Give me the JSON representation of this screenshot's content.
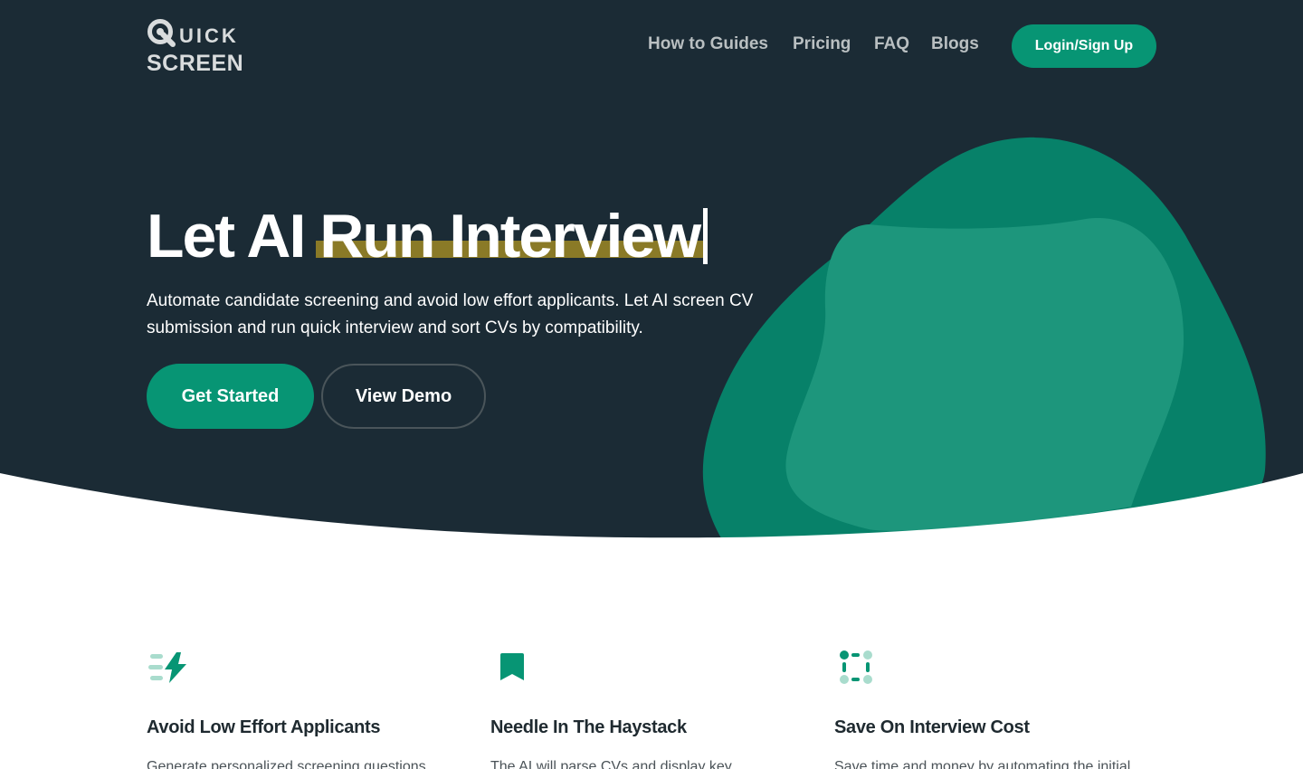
{
  "brand": {
    "line1": "UICK",
    "line2": "SCREEN",
    "q_letter": "Q"
  },
  "nav": {
    "items": [
      {
        "label": "How to Guides"
      },
      {
        "label": "Pricing"
      },
      {
        "label": "FAQ"
      },
      {
        "label": "Blogs"
      }
    ],
    "login_label": "Login/Sign Up"
  },
  "hero": {
    "headline_plain": "Let AI ",
    "headline_highlight": "Run Interview",
    "subtitle": "Automate candidate screening and avoid low effort applicants. Let AI screen CV submission and run quick interview and sort CVs by compatibility.",
    "primary_cta": "Get Started",
    "secondary_cta": "View Demo"
  },
  "features": [
    {
      "icon": "bolt-icon",
      "title": "Avoid Low Effort Applicants",
      "text": "Generate personalized screening questions"
    },
    {
      "icon": "bookmark-icon",
      "title": "Needle In The Haystack",
      "text": "The AI will parse CVs and display key"
    },
    {
      "icon": "dots-grid-icon",
      "title": "Save On Interview Cost",
      "text": "Save time and money by automating the initial"
    }
  ],
  "colors": {
    "hero_bg": "#1b2b35",
    "accent": "#079574",
    "highlight": "#8a7a27",
    "nav_text": "#b9bfc1"
  }
}
